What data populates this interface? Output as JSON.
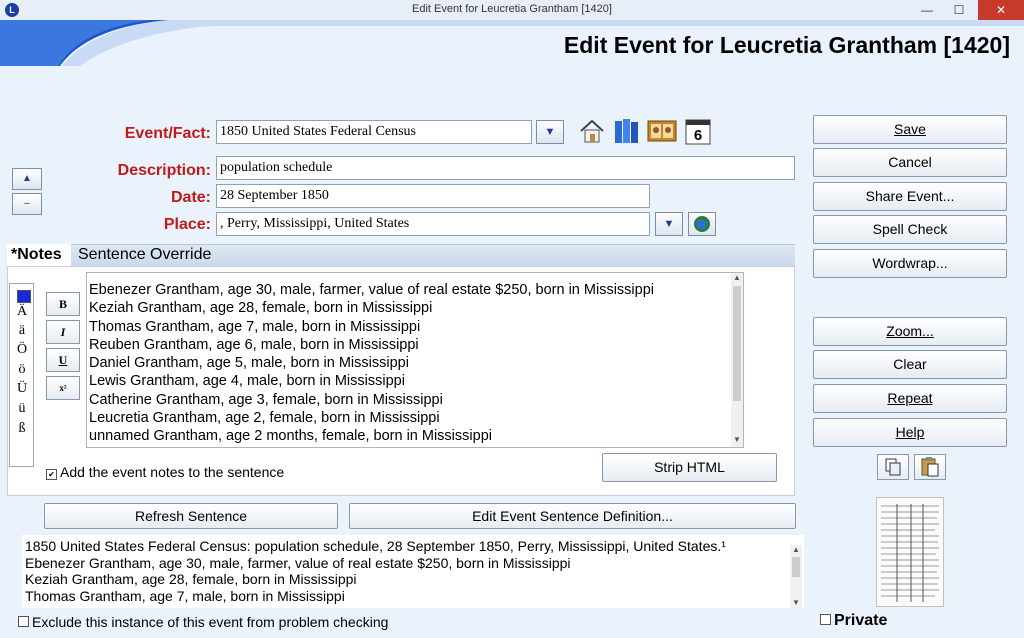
{
  "window": {
    "title": "Edit Event for Leucretia Grantham [1420]",
    "close_glyph": "✕",
    "min_glyph": "—",
    "max_glyph": "☐"
  },
  "header": {
    "title": "Edit Event for Leucretia Grantham [1420]"
  },
  "app_icon_letter": "L",
  "form": {
    "event_label": "Event/Fact:",
    "event_value": "1850 United States Federal Census",
    "description_label": "Description:",
    "description_value": "population schedule",
    "date_label": "Date:",
    "date_value": "28 September 1850",
    "place_label": "Place:",
    "place_value": ", Perry, Mississippi, United States",
    "calendar_number": "6"
  },
  "tabs": {
    "notes": "*Notes",
    "override": "Sentence Override"
  },
  "chars": [
    "Ä",
    "ä",
    "Ö",
    "ö",
    "Ü",
    "ü",
    "ß"
  ],
  "format_buttons": {
    "bold": "B",
    "italic": "I",
    "underline": "U",
    "superscript": "x²"
  },
  "notes": [
    "Ebenezer Grantham, age 30, male, farmer, value of real estate $250, born in Mississippi",
    "Keziah Grantham, age 28, female, born in Mississippi",
    "Thomas Grantham, age 7, male, born in Mississippi",
    "Reuben Grantham, age 6, male, born in Mississippi",
    "Daniel Grantham, age 5, male, born in Mississippi",
    "Lewis Grantham, age 4, male, born in Mississippi",
    "Catherine Grantham, age 3, female, born in Mississippi",
    "Leucretia Grantham, age 2, female, born in Mississippi",
    "unnamed Grantham, age 2 months, female, born in Mississippi"
  ],
  "add_notes_label": "Add the event notes to the sentence",
  "add_notes_checked": true,
  "buttons": {
    "strip_html": "Strip HTML",
    "refresh": "Refresh Sentence",
    "edit_def": "Edit Event Sentence Definition...",
    "save": "Save",
    "cancel": "Cancel",
    "share": "Share Event...",
    "spell": "Spell Check",
    "wordwrap": "Wordwrap...",
    "zoom": "Zoom...",
    "clear": "Clear",
    "repeat": "Repeat",
    "help": "Help"
  },
  "sentence": [
    "1850 United States Federal Census: population schedule, 28 September 1850, Perry, Mississippi, United States.¹",
    "Ebenezer Grantham, age 30, male, farmer, value of real estate $250, born in Mississippi",
    "Keziah Grantham, age 28, female, born in Mississippi",
    "Thomas Grantham, age 7, male, born in Mississippi"
  ],
  "exclude_label": "Exclude this instance of this event from problem checking",
  "private_label": "Private",
  "icons": {
    "home": "house-icon",
    "books": "books-icon",
    "photos": "photo-album-icon",
    "calendar": "calendar-icon",
    "globe": "globe-icon",
    "copy": "copy-icon",
    "paste": "paste-icon"
  }
}
